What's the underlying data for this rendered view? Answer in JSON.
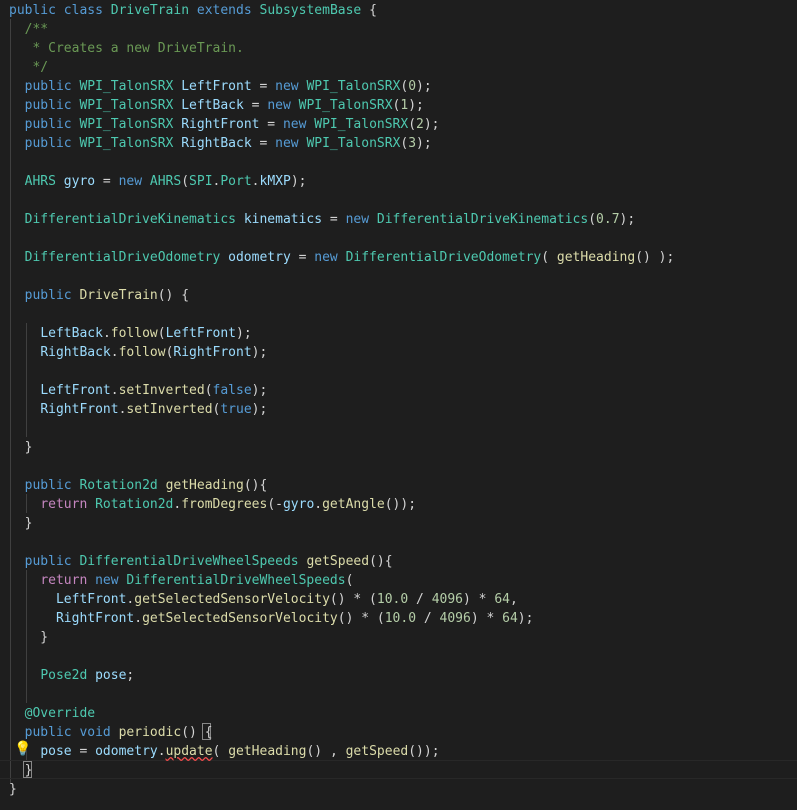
{
  "editor": {
    "theme": "dark",
    "lines": [
      [
        [
          "kw",
          "public"
        ],
        [
          "pl",
          " "
        ],
        [
          "kw",
          "class"
        ],
        [
          "pl",
          " "
        ],
        [
          "ty",
          "DriveTrain"
        ],
        [
          "pl",
          " "
        ],
        [
          "kw",
          "extends"
        ],
        [
          "pl",
          " "
        ],
        [
          "ty",
          "SubsystemBase"
        ],
        [
          "pl",
          " {"
        ]
      ],
      [
        [
          "cm",
          "  /**"
        ]
      ],
      [
        [
          "cm",
          "   * Creates a new DriveTrain."
        ]
      ],
      [
        [
          "cm",
          "   */"
        ]
      ],
      [
        [
          "pl",
          "  "
        ],
        [
          "kw",
          "public"
        ],
        [
          "pl",
          " "
        ],
        [
          "ty",
          "WPI_TalonSRX"
        ],
        [
          "pl",
          " "
        ],
        [
          "va",
          "LeftFront"
        ],
        [
          "pl",
          " = "
        ],
        [
          "kw",
          "new"
        ],
        [
          "pl",
          " "
        ],
        [
          "ty",
          "WPI_TalonSRX"
        ],
        [
          "pl",
          "("
        ],
        [
          "nu",
          "0"
        ],
        [
          "pl",
          ");"
        ]
      ],
      [
        [
          "pl",
          "  "
        ],
        [
          "kw",
          "public"
        ],
        [
          "pl",
          " "
        ],
        [
          "ty",
          "WPI_TalonSRX"
        ],
        [
          "pl",
          " "
        ],
        [
          "va",
          "LeftBack"
        ],
        [
          "pl",
          " = "
        ],
        [
          "kw",
          "new"
        ],
        [
          "pl",
          " "
        ],
        [
          "ty",
          "WPI_TalonSRX"
        ],
        [
          "pl",
          "("
        ],
        [
          "nu",
          "1"
        ],
        [
          "pl",
          ");"
        ]
      ],
      [
        [
          "pl",
          "  "
        ],
        [
          "kw",
          "public"
        ],
        [
          "pl",
          " "
        ],
        [
          "ty",
          "WPI_TalonSRX"
        ],
        [
          "pl",
          " "
        ],
        [
          "va",
          "RightFront"
        ],
        [
          "pl",
          " = "
        ],
        [
          "kw",
          "new"
        ],
        [
          "pl",
          " "
        ],
        [
          "ty",
          "WPI_TalonSRX"
        ],
        [
          "pl",
          "("
        ],
        [
          "nu",
          "2"
        ],
        [
          "pl",
          ");"
        ]
      ],
      [
        [
          "pl",
          "  "
        ],
        [
          "kw",
          "public"
        ],
        [
          "pl",
          " "
        ],
        [
          "ty",
          "WPI_TalonSRX"
        ],
        [
          "pl",
          " "
        ],
        [
          "va",
          "RightBack"
        ],
        [
          "pl",
          " = "
        ],
        [
          "kw",
          "new"
        ],
        [
          "pl",
          " "
        ],
        [
          "ty",
          "WPI_TalonSRX"
        ],
        [
          "pl",
          "("
        ],
        [
          "nu",
          "3"
        ],
        [
          "pl",
          ");"
        ]
      ],
      [],
      [
        [
          "pl",
          "  "
        ],
        [
          "ty",
          "AHRS"
        ],
        [
          "pl",
          " "
        ],
        [
          "va",
          "gyro"
        ],
        [
          "pl",
          " = "
        ],
        [
          "kw",
          "new"
        ],
        [
          "pl",
          " "
        ],
        [
          "ty",
          "AHRS"
        ],
        [
          "pl",
          "("
        ],
        [
          "ty",
          "SPI"
        ],
        [
          "pl",
          "."
        ],
        [
          "ty",
          "Port"
        ],
        [
          "pl",
          "."
        ],
        [
          "va",
          "kMXP"
        ],
        [
          "pl",
          ");"
        ]
      ],
      [],
      [
        [
          "pl",
          "  "
        ],
        [
          "ty",
          "DifferentialDriveKinematics"
        ],
        [
          "pl",
          " "
        ],
        [
          "va",
          "kinematics"
        ],
        [
          "pl",
          " = "
        ],
        [
          "kw",
          "new"
        ],
        [
          "pl",
          " "
        ],
        [
          "ty",
          "DifferentialDriveKinematics"
        ],
        [
          "pl",
          "("
        ],
        [
          "nu",
          "0.7"
        ],
        [
          "pl",
          ");"
        ]
      ],
      [],
      [
        [
          "pl",
          "  "
        ],
        [
          "ty",
          "DifferentialDriveOdometry"
        ],
        [
          "pl",
          " "
        ],
        [
          "va",
          "odometry"
        ],
        [
          "pl",
          " = "
        ],
        [
          "kw",
          "new"
        ],
        [
          "pl",
          " "
        ],
        [
          "ty",
          "DifferentialDriveOdometry"
        ],
        [
          "pl",
          "( "
        ],
        [
          "fn",
          "getHeading"
        ],
        [
          "pl",
          "() );"
        ]
      ],
      [],
      [
        [
          "pl",
          "  "
        ],
        [
          "kw",
          "public"
        ],
        [
          "pl",
          " "
        ],
        [
          "fn",
          "DriveTrain"
        ],
        [
          "pl",
          "() {"
        ]
      ],
      [],
      [
        [
          "pl",
          "    "
        ],
        [
          "va",
          "LeftBack"
        ],
        [
          "pl",
          "."
        ],
        [
          "fn",
          "follow"
        ],
        [
          "pl",
          "("
        ],
        [
          "va",
          "LeftFront"
        ],
        [
          "pl",
          ");"
        ]
      ],
      [
        [
          "pl",
          "    "
        ],
        [
          "va",
          "RightBack"
        ],
        [
          "pl",
          "."
        ],
        [
          "fn",
          "follow"
        ],
        [
          "pl",
          "("
        ],
        [
          "va",
          "RightFront"
        ],
        [
          "pl",
          ");"
        ]
      ],
      [],
      [
        [
          "pl",
          "    "
        ],
        [
          "va",
          "LeftFront"
        ],
        [
          "pl",
          "."
        ],
        [
          "fn",
          "setInverted"
        ],
        [
          "pl",
          "("
        ],
        [
          "kw",
          "false"
        ],
        [
          "pl",
          ");"
        ]
      ],
      [
        [
          "pl",
          "    "
        ],
        [
          "va",
          "RightFront"
        ],
        [
          "pl",
          "."
        ],
        [
          "fn",
          "setInverted"
        ],
        [
          "pl",
          "("
        ],
        [
          "kw",
          "true"
        ],
        [
          "pl",
          ");"
        ]
      ],
      [],
      [
        [
          "pl",
          "  }"
        ]
      ],
      [],
      [
        [
          "pl",
          "  "
        ],
        [
          "kw",
          "public"
        ],
        [
          "pl",
          " "
        ],
        [
          "ty",
          "Rotation2d"
        ],
        [
          "pl",
          " "
        ],
        [
          "fn",
          "getHeading"
        ],
        [
          "pl",
          "(){"
        ]
      ],
      [
        [
          "pl",
          "    "
        ],
        [
          "cf",
          "return"
        ],
        [
          "pl",
          " "
        ],
        [
          "ty",
          "Rotation2d"
        ],
        [
          "pl",
          "."
        ],
        [
          "fn",
          "fromDegrees"
        ],
        [
          "pl",
          "(-"
        ],
        [
          "va",
          "gyro"
        ],
        [
          "pl",
          "."
        ],
        [
          "fn",
          "getAngle"
        ],
        [
          "pl",
          "());"
        ]
      ],
      [
        [
          "pl",
          "  }"
        ]
      ],
      [],
      [
        [
          "pl",
          "  "
        ],
        [
          "kw",
          "public"
        ],
        [
          "pl",
          " "
        ],
        [
          "ty",
          "DifferentialDriveWheelSpeeds"
        ],
        [
          "pl",
          " "
        ],
        [
          "fn",
          "getSpeed"
        ],
        [
          "pl",
          "(){"
        ]
      ],
      [
        [
          "pl",
          "    "
        ],
        [
          "cf",
          "return"
        ],
        [
          "pl",
          " "
        ],
        [
          "kw",
          "new"
        ],
        [
          "pl",
          " "
        ],
        [
          "ty",
          "DifferentialDriveWheelSpeeds"
        ],
        [
          "pl",
          "("
        ]
      ],
      [
        [
          "pl",
          "      "
        ],
        [
          "va",
          "LeftFront"
        ],
        [
          "pl",
          "."
        ],
        [
          "fn",
          "getSelectedSensorVelocity"
        ],
        [
          "pl",
          "() * ("
        ],
        [
          "nu",
          "10.0"
        ],
        [
          "pl",
          " / "
        ],
        [
          "nu",
          "4096"
        ],
        [
          "pl",
          ") * "
        ],
        [
          "nu",
          "64"
        ],
        [
          "pl",
          ","
        ]
      ],
      [
        [
          "pl",
          "      "
        ],
        [
          "va",
          "RightFront"
        ],
        [
          "pl",
          "."
        ],
        [
          "fn",
          "getSelectedSensorVelocity"
        ],
        [
          "pl",
          "() * ("
        ],
        [
          "nu",
          "10.0"
        ],
        [
          "pl",
          " / "
        ],
        [
          "nu",
          "4096"
        ],
        [
          "pl",
          ") * "
        ],
        [
          "nu",
          "64"
        ],
        [
          "pl",
          ");"
        ]
      ],
      [
        [
          "pl",
          "    }"
        ]
      ],
      [],
      [
        [
          "pl",
          "    "
        ],
        [
          "ty",
          "Pose2d"
        ],
        [
          "pl",
          " "
        ],
        [
          "va",
          "pose"
        ],
        [
          "pl",
          ";"
        ]
      ],
      [],
      [
        [
          "pl",
          "  "
        ],
        [
          "ty",
          "@Override"
        ]
      ],
      [
        [
          "pl",
          "  "
        ],
        [
          "kw",
          "public"
        ],
        [
          "pl",
          " "
        ],
        [
          "kw",
          "void"
        ],
        [
          "pl",
          " "
        ],
        [
          "fn",
          "periodic"
        ],
        [
          "pl",
          "() {"
        ]
      ],
      [
        [
          "pl",
          "    "
        ],
        [
          "va",
          "pose"
        ],
        [
          "pl",
          " = "
        ],
        [
          "va",
          "odometry"
        ],
        [
          "pl",
          "."
        ],
        [
          "fn",
          "update",
          "err"
        ],
        [
          "pl",
          "( "
        ],
        [
          "fn",
          "getHeading"
        ],
        [
          "pl",
          "() , "
        ],
        [
          "fn",
          "getSpeed"
        ],
        [
          "pl",
          "());"
        ]
      ],
      [
        [
          "pl",
          "  }"
        ]
      ],
      [
        [
          "pl",
          "}"
        ]
      ]
    ]
  },
  "icons": {
    "lightbulb": "lightbulb-icon"
  }
}
